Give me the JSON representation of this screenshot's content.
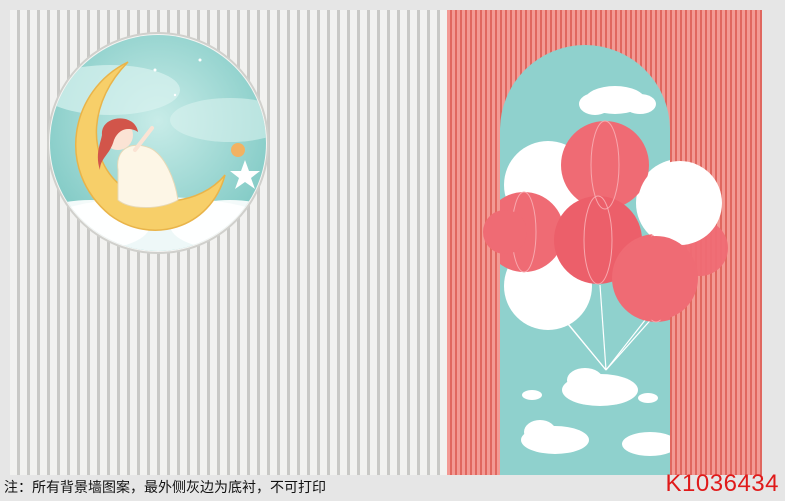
{
  "footer": {
    "note": "注：所有背景墙图案，最外侧灰边为底衬，不可打印",
    "product_code": "K1036434"
  },
  "colors": {
    "accent_red": "#e01a1a",
    "stripe_grey": "#c9c9c6",
    "stripe_pink": "#e0675f",
    "sky_teal": "#8fd1cd",
    "moon_yellow": "#f7cf69",
    "balloon_pink": "#ef6b74"
  },
  "artwork": {
    "left_panel": "grey-vertical-stripes",
    "medallion": "girl-on-crescent-moon",
    "right_panel": "pink-vertical-stripes",
    "arch": "balloon-bunch-in-sky-arch"
  }
}
